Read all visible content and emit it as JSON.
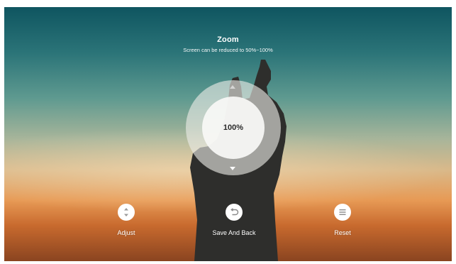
{
  "header": {
    "title": "Zoom",
    "subtitle": "Screen can be reduced to 50%~100%"
  },
  "dial": {
    "value": "100%"
  },
  "actions": [
    {
      "label": "Adjust",
      "icon": "up-down-arrows-icon"
    },
    {
      "label": "Save And Back",
      "icon": "return-icon"
    },
    {
      "label": "Reset",
      "icon": "menu-lines-icon"
    }
  ],
  "colors": {
    "sky_top": "#0f5560",
    "sky_horizon": "#e79a55",
    "silhouette": "#2e2e2c",
    "control_fill": "#ffffff"
  }
}
